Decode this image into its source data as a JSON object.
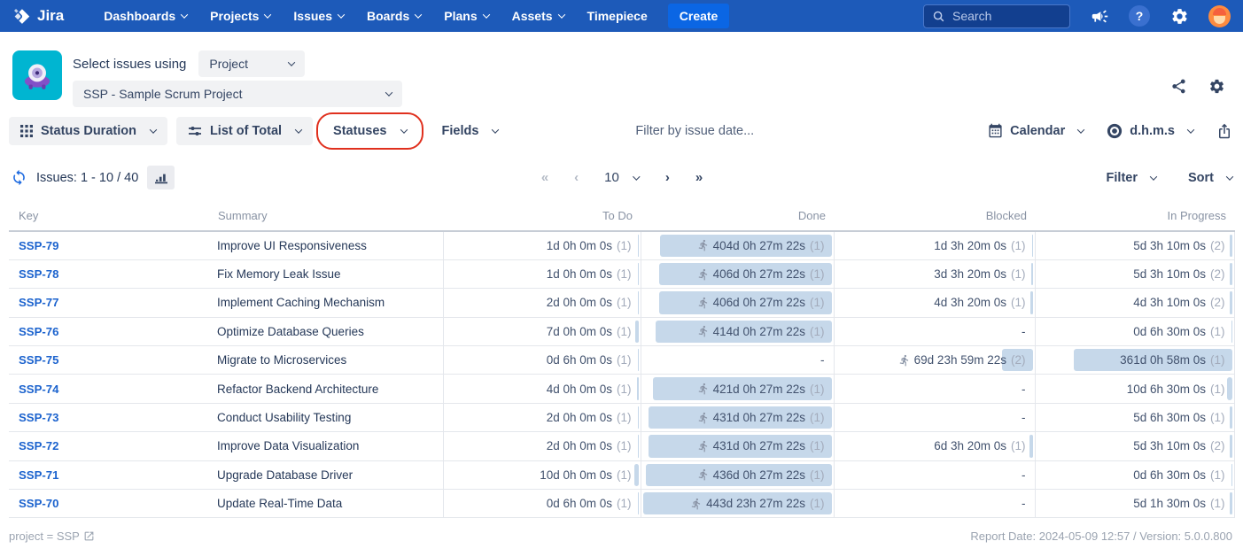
{
  "colors": {
    "nav_bg": "#1d5ab9",
    "create_bg": "#0b66e4",
    "bar_blue": "#c6d8ea",
    "annotation_red": "#e0301e",
    "link_blue": "#1c63ce"
  },
  "topnav": {
    "logo_text": "Jira",
    "items": [
      {
        "label": "Dashboards",
        "dropdown": true
      },
      {
        "label": "Projects",
        "dropdown": true
      },
      {
        "label": "Issues",
        "dropdown": true
      },
      {
        "label": "Boards",
        "dropdown": true
      },
      {
        "label": "Plans",
        "dropdown": true
      },
      {
        "label": "Assets",
        "dropdown": true
      },
      {
        "label": "Timepiece",
        "dropdown": false
      }
    ],
    "create_label": "Create",
    "search_placeholder": "Search"
  },
  "header": {
    "select_label": "Select issues using",
    "select_value": "Project",
    "project_value": "SSP - Sample Scrum Project"
  },
  "toolbar": {
    "report_type": "Status Duration",
    "view_mode": "List of Total",
    "statuses_label": "Statuses",
    "fields_label": "Fields",
    "date_filter_placeholder": "Filter by issue date...",
    "calendar_label": "Calendar",
    "format_label": "d.h.m.s"
  },
  "listbar": {
    "issues_count": "Issues: 1 - 10 / 40",
    "first": "«",
    "prev": "‹",
    "next": "›",
    "last": "»",
    "page_size": "10",
    "filter_label": "Filter",
    "sort_label": "Sort"
  },
  "table": {
    "columns": [
      "Key",
      "Summary",
      "To Do",
      "Done",
      "Blocked",
      "In Progress"
    ],
    "bar_scale_days": 444,
    "rows": [
      {
        "key": "SSP-79",
        "summary": "Improve UI Responsiveness",
        "todo": {
          "text": "1d 0h 0m 0s",
          "count": "(1)",
          "days": 1
        },
        "done": {
          "text": "404d 0h 27m 22s",
          "count": "(1)",
          "days": 404,
          "runner": true
        },
        "blocked": {
          "text": "1d 3h 20m 0s",
          "count": "(1)",
          "days": 1.14
        },
        "inprogress": {
          "text": "5d 3h 10m 0s",
          "count": "(2)",
          "days": 5.13
        }
      },
      {
        "key": "SSP-78",
        "summary": "Fix Memory Leak Issue",
        "todo": {
          "text": "1d 0h 0m 0s",
          "count": "(1)",
          "days": 1
        },
        "done": {
          "text": "406d 0h 27m 22s",
          "count": "(1)",
          "days": 406,
          "runner": true
        },
        "blocked": {
          "text": "3d 3h 20m 0s",
          "count": "(1)",
          "days": 3.14
        },
        "inprogress": {
          "text": "5d 3h 10m 0s",
          "count": "(2)",
          "days": 5.13
        }
      },
      {
        "key": "SSP-77",
        "summary": "Implement Caching Mechanism",
        "todo": {
          "text": "2d 0h 0m 0s",
          "count": "(1)",
          "days": 2
        },
        "done": {
          "text": "406d 0h 27m 22s",
          "count": "(1)",
          "days": 406,
          "runner": true
        },
        "blocked": {
          "text": "4d 3h 20m 0s",
          "count": "(1)",
          "days": 4.14
        },
        "inprogress": {
          "text": "4d 3h 10m 0s",
          "count": "(2)",
          "days": 4.13
        }
      },
      {
        "key": "SSP-76",
        "summary": "Optimize Database Queries",
        "todo": {
          "text": "7d 0h 0m 0s",
          "count": "(1)",
          "days": 7
        },
        "done": {
          "text": "414d 0h 27m 22s",
          "count": "(1)",
          "days": 414,
          "runner": true
        },
        "blocked": {
          "text": "-"
        },
        "inprogress": {
          "text": "0d 6h 30m 0s",
          "count": "(1)",
          "days": 0.27
        }
      },
      {
        "key": "SSP-75",
        "summary": "Migrate to Microservices",
        "todo": {
          "text": "0d 6h 0m 0s",
          "count": "(1)",
          "days": 0.25
        },
        "done": {
          "text": "-"
        },
        "blocked": {
          "text": "69d 23h 59m 22s",
          "count": "(2)",
          "days": 70,
          "runner": true
        },
        "inprogress": {
          "text": "361d 0h 58m 0s",
          "count": "(1)",
          "days": 361
        }
      },
      {
        "key": "SSP-74",
        "summary": "Refactor Backend Architecture",
        "todo": {
          "text": "4d 0h 0m 0s",
          "count": "(1)",
          "days": 4
        },
        "done": {
          "text": "421d 0h 27m 22s",
          "count": "(1)",
          "days": 421,
          "runner": true
        },
        "blocked": {
          "text": "-"
        },
        "inprogress": {
          "text": "10d 6h 30m 0s",
          "count": "(1)",
          "days": 10.27
        }
      },
      {
        "key": "SSP-73",
        "summary": "Conduct Usability Testing",
        "todo": {
          "text": "2d 0h 0m 0s",
          "count": "(1)",
          "days": 2
        },
        "done": {
          "text": "431d 0h 27m 22s",
          "count": "(1)",
          "days": 431,
          "runner": true
        },
        "blocked": {
          "text": "-"
        },
        "inprogress": {
          "text": "5d 6h 30m 0s",
          "count": "(1)",
          "days": 5.27
        }
      },
      {
        "key": "SSP-72",
        "summary": "Improve Data Visualization",
        "todo": {
          "text": "2d 0h 0m 0s",
          "count": "(1)",
          "days": 2
        },
        "done": {
          "text": "431d 0h 27m 22s",
          "count": "(1)",
          "days": 431,
          "runner": true
        },
        "blocked": {
          "text": "6d 3h 20m 0s",
          "count": "(1)",
          "days": 6.14
        },
        "inprogress": {
          "text": "5d 3h 10m 0s",
          "count": "(2)",
          "days": 5.13
        }
      },
      {
        "key": "SSP-71",
        "summary": "Upgrade Database Driver",
        "todo": {
          "text": "10d 0h 0m 0s",
          "count": "(1)",
          "days": 10
        },
        "done": {
          "text": "436d 0h 27m 22s",
          "count": "(1)",
          "days": 436,
          "runner": true
        },
        "blocked": {
          "text": "-"
        },
        "inprogress": {
          "text": "0d 6h 30m 0s",
          "count": "(1)",
          "days": 0.27
        }
      },
      {
        "key": "SSP-70",
        "summary": "Update Real-Time Data",
        "todo": {
          "text": "0d 6h 0m 0s",
          "count": "(1)",
          "days": 0.25
        },
        "done": {
          "text": "443d 23h 27m 22s",
          "count": "(1)",
          "days": 443.98,
          "runner": true
        },
        "blocked": {
          "text": "-"
        },
        "inprogress": {
          "text": "5d 1h 30m 0s",
          "count": "(1)",
          "days": 5.06
        }
      }
    ]
  },
  "footer": {
    "jql_text": "project = SSP",
    "report_info": "Report Date: 2024-05-09 12:57 / Version: 5.0.0.800"
  }
}
